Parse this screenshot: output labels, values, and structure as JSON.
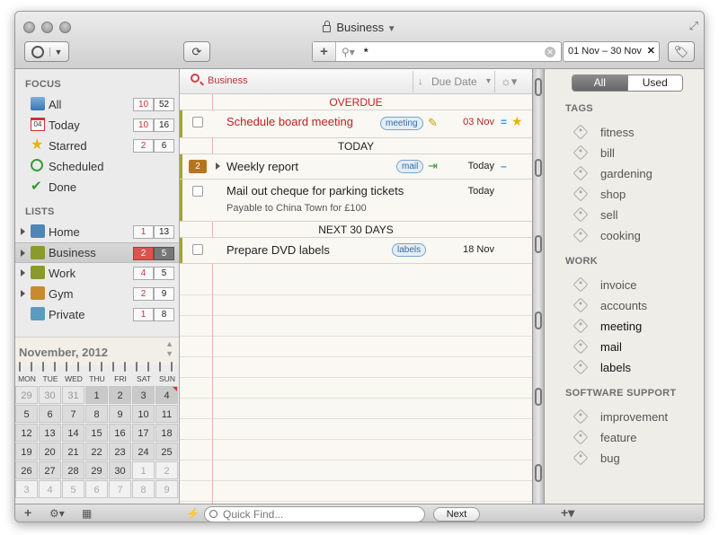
{
  "window": {
    "title": "Business"
  },
  "toolbar": {
    "search_value": "*",
    "date_range": "01 Nov – 30 Nov"
  },
  "sidebar": {
    "focus_header": "FOCUS",
    "focus": [
      {
        "label": "All",
        "count_a": "10",
        "count_b": "52",
        "icon": "all-icon"
      },
      {
        "label": "Today",
        "count_a": "10",
        "count_b": "16",
        "icon": "calendar-today-icon",
        "icon_text": "04"
      },
      {
        "label": "Starred",
        "count_a": "2",
        "count_b": "6",
        "icon": "star-icon"
      },
      {
        "label": "Scheduled",
        "icon": "clock-icon"
      },
      {
        "label": "Done",
        "icon": "checkmark-icon"
      }
    ],
    "lists_header": "LISTS",
    "lists": [
      {
        "label": "Home",
        "count_a": "1",
        "count_b": "13",
        "color": "#4f86b5"
      },
      {
        "label": "Business",
        "count_a": "2",
        "count_b": "5",
        "color": "#8a9a2b"
      },
      {
        "label": "Work",
        "count_a": "4",
        "count_b": "5",
        "color": "#8a9a2b"
      },
      {
        "label": "Gym",
        "count_a": "2",
        "count_b": "9",
        "color": "#c88a2e"
      },
      {
        "label": "Private",
        "count_a": "1",
        "count_b": "8",
        "color": "#5a9cbf"
      }
    ]
  },
  "calendar": {
    "month": "November, 2012",
    "dows": [
      "MON",
      "TUE",
      "WED",
      "THU",
      "FRI",
      "SAT",
      "SUN"
    ],
    "weeks": [
      [
        "29",
        "30",
        "31",
        "1",
        "2",
        "3",
        "4"
      ],
      [
        "5",
        "6",
        "7",
        "8",
        "9",
        "10",
        "11"
      ],
      [
        "12",
        "13",
        "14",
        "15",
        "16",
        "17",
        "18"
      ],
      [
        "19",
        "20",
        "21",
        "22",
        "23",
        "24",
        "25"
      ],
      [
        "26",
        "27",
        "28",
        "29",
        "30",
        "1",
        "2"
      ],
      [
        "3",
        "4",
        "5",
        "6",
        "7",
        "8",
        "9"
      ]
    ]
  },
  "tasks": {
    "header_title": "Business",
    "sort_label": "Due Date",
    "groups": [
      {
        "label": "OVERDUE",
        "color": "#b22"
      },
      {
        "label": "TODAY",
        "color": "#333"
      },
      {
        "label": "NEXT 30 DAYS",
        "color": "#333"
      }
    ],
    "items": [
      {
        "name": "Schedule board meeting",
        "tag": "meeting",
        "date": "03 Nov",
        "overdue": true
      },
      {
        "name": "Weekly report",
        "tag": "mail",
        "date": "Today",
        "badge": "2"
      },
      {
        "name": "Mail out cheque for parking tickets",
        "note": "Payable to China Town for £100",
        "date": "Today"
      },
      {
        "name": "Prepare DVD labels",
        "tag": "labels",
        "date": "18 Nov"
      }
    ]
  },
  "tags_panel": {
    "tab_all": "All",
    "tab_used": "Used",
    "sections": [
      {
        "header": "TAGS",
        "items": [
          "fitness",
          "bill",
          "gardening",
          "shop",
          "sell",
          "cooking"
        ]
      },
      {
        "header": "WORK",
        "items": [
          "invoice",
          "accounts",
          "meeting",
          "mail",
          "labels"
        ]
      },
      {
        "header": "SOFTWARE SUPPORT",
        "items": [
          "improvement",
          "feature",
          "bug"
        ]
      }
    ]
  },
  "bottom": {
    "quick_find_placeholder": "Quick Find...",
    "next_label": "Next"
  }
}
